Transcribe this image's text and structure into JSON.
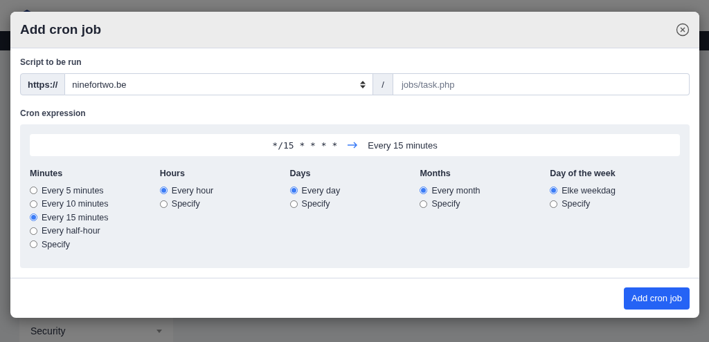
{
  "background": {
    "sidebar_items": [
      "Security"
    ]
  },
  "dialog": {
    "title": "Add cron job",
    "script": {
      "label": "Script to be run",
      "prefix": "https://",
      "domain": "ninefortwo.be",
      "separator": "/",
      "path_placeholder": "jobs/task.php"
    },
    "cron": {
      "label": "Cron expression",
      "expression": "*/15 * * * *",
      "description": "Every 15 minutes",
      "groups": [
        {
          "title": "Minutes",
          "options": [
            {
              "label": "Every 5 minutes",
              "selected": false
            },
            {
              "label": "Every 10 minutes",
              "selected": false
            },
            {
              "label": "Every 15 minutes",
              "selected": true
            },
            {
              "label": "Every half-hour",
              "selected": false
            },
            {
              "label": "Specify",
              "selected": false
            }
          ]
        },
        {
          "title": "Hours",
          "options": [
            {
              "label": "Every hour",
              "selected": true
            },
            {
              "label": "Specify",
              "selected": false
            }
          ]
        },
        {
          "title": "Days",
          "options": [
            {
              "label": "Every day",
              "selected": true
            },
            {
              "label": "Specify",
              "selected": false
            }
          ]
        },
        {
          "title": "Months",
          "options": [
            {
              "label": "Every month",
              "selected": true
            },
            {
              "label": "Specify",
              "selected": false
            }
          ]
        },
        {
          "title": "Day of the week",
          "options": [
            {
              "label": "Elke weekdag",
              "selected": true
            },
            {
              "label": "Specify",
              "selected": false
            }
          ]
        }
      ]
    },
    "submit": "Add cron job"
  }
}
